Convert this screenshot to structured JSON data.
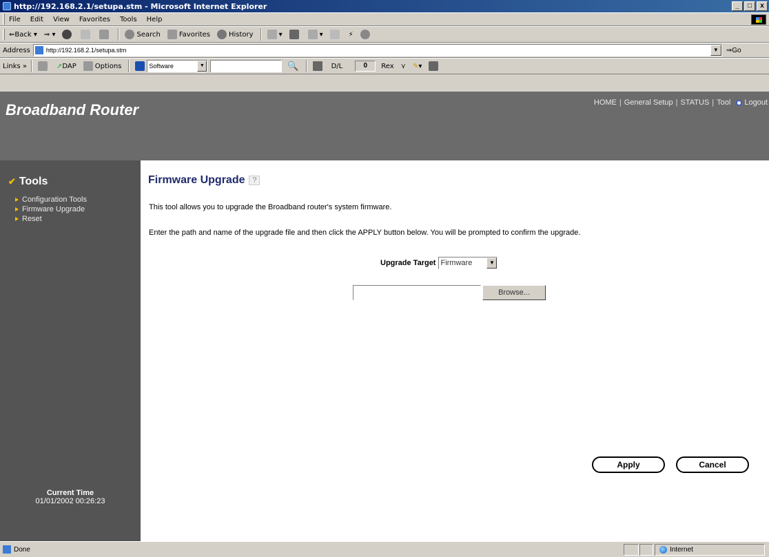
{
  "window": {
    "title": "http://192.168.2.1/setupa.stm - Microsoft Internet Explorer",
    "min": "_",
    "max": "□",
    "close": "x"
  },
  "menu": [
    "File",
    "Edit",
    "View",
    "Favorites",
    "Tools",
    "Help"
  ],
  "toolbar": {
    "back": "Back",
    "forward": "⇒",
    "search": "Search",
    "favorites": "Favorites",
    "history": "History"
  },
  "address": {
    "label": "Address",
    "url": "http://192.168.2.1/setupa.stm",
    "go": "Go"
  },
  "links": {
    "label": "Links »",
    "dap": "DAP",
    "options": "Options",
    "software": "Software",
    "dl_label": "D/L",
    "dl_value": "0",
    "rex": "Rex"
  },
  "header": {
    "brand": "Broadband Router",
    "nav": [
      "HOME",
      "General Setup",
      "STATUS",
      "Tool",
      "Logout"
    ]
  },
  "sidebar": {
    "heading": "Tools",
    "items": [
      "Configuration Tools",
      "Firmware Upgrade",
      "Reset"
    ],
    "current_time_label": "Current Time",
    "current_time_value": "01/01/2002 00:26:23"
  },
  "main": {
    "title": "Firmware Upgrade",
    "help_icon": "?",
    "desc1": "This tool allows you to upgrade the Broadband router's system firmware.",
    "desc2": "Enter the path and name of the upgrade file and then click the APPLY button below. You will be prompted to confirm the upgrade.",
    "target_label": "Upgrade Target",
    "target_value": "Firmware",
    "browse": "Browse...",
    "apply": "Apply",
    "cancel": "Cancel"
  },
  "status": {
    "text": "Done",
    "zone": "Internet"
  }
}
